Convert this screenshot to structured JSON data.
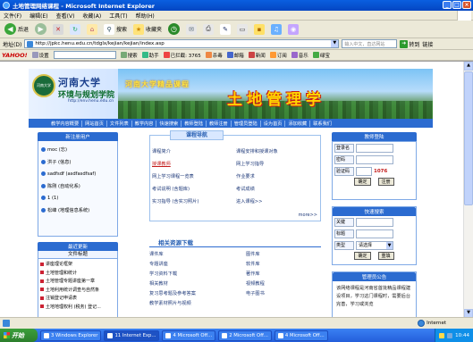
{
  "window": {
    "title": "土地管理网络课程 - Microsoft Internet Explorer"
  },
  "menu": [
    "文件(F)",
    "编辑(E)",
    "查看(V)",
    "收藏(A)",
    "工具(T)",
    "帮助(H)"
  ],
  "toolbar": {
    "back": "后退",
    "search": "搜索",
    "favorites": "收藏夹"
  },
  "address": {
    "label": "地址(D)",
    "url": "http://jpkc.henu.edu.cn/tdglx/kejian/kejian/index.asp",
    "search_placeholder": "输入中文，直达网站",
    "go": "转到",
    "links": "链接"
  },
  "yahoo": {
    "logo": "YAHOO!",
    "settings": "设置",
    "search": "搜索",
    "helper": "助手",
    "blocked": "已拦截: 3765",
    "star": "杀毒",
    "mail": "邮箱",
    "news": "新闻",
    "subscribe": "订阅",
    "music": "音乐",
    "pic": "绿宝"
  },
  "banner": {
    "logo_text": "河南大学",
    "uni_name": "河南大学",
    "uni_sub": "环境与规划学院",
    "uni_url": "http://env.henu.edu.cn",
    "course_line": "河南大学精品课程",
    "course_name": "土地管理学"
  },
  "nav": [
    "教学内容概要",
    "网站首页",
    "文件列表",
    "教学内容",
    "快速搜索",
    "教师登陆",
    "教师注册",
    "管理员登陆",
    "设为首页",
    "添加收藏",
    "联系我们"
  ],
  "online_users": {
    "heading": "新注册用户",
    "items": [
      "moc (忘)",
      "洪子 (信息)",
      "sadfsdf (asdfasdfsaf)",
      "陈刚 (自动化系)",
      "1 (1)",
      "松峰 (地理信息系统)"
    ]
  },
  "latest": {
    "heading": "最近更新",
    "subheading": "文件标题",
    "items": [
      "讲座理论框架",
      "土地管理和统计",
      "土地管理专题讲座第一章",
      "土地利用统计调查与自然条",
      "注销登记申请表",
      "土地地理权利 (税务) 登记..."
    ]
  },
  "course_nav": {
    "caption": "课程导航",
    "items": [
      {
        "label": "课程简介",
        "red": false
      },
      {
        "label": "课程安排和授课对象",
        "red": false
      },
      {
        "label": "授课教师",
        "red": true
      },
      {
        "label": "网上学习指导",
        "red": false
      },
      {
        "label": "网上学习课程一览表",
        "red": false
      },
      {
        "label": "作业要求",
        "red": false
      },
      {
        "label": "考试说明 (含题库)",
        "red": false
      },
      {
        "label": "考试成绩",
        "red": false
      },
      {
        "label": "实习指导 (含实习照片)",
        "red": false
      },
      {
        "label": "进入课程>>",
        "red": false
      }
    ],
    "more": "more>>"
  },
  "resources": {
    "caption": "相关资源下载",
    "items": [
      "课件库",
      "图件库",
      "专题讲座",
      "软件库",
      "学习资料下载",
      "著作库",
      "相关教材",
      "视频教程",
      "复习思考题及参考答案",
      "电子图书",
      "教学素材照片与视频",
      ""
    ]
  },
  "login": {
    "heading": "教师登陆",
    "username_label": "登录名",
    "password_label": "密码",
    "code_label": "验证码",
    "code": "1076",
    "submit": "确定",
    "register": "注册"
  },
  "quick_search": {
    "heading": "快速搜索",
    "keyword_label": "关键",
    "title_label": "标题",
    "type_label": "类型",
    "type_value": "请选择",
    "submit": "确定",
    "reset": "重填"
  },
  "management": {
    "heading": "管理员公告",
    "text": "该网络课程是河南省首批精品课程建设项目，学习这门课程时，需要后台完善，学习或浏览"
  },
  "status": {
    "zone": "Internet"
  },
  "taskbar": {
    "start": "开始",
    "tasks": [
      "3 Windows Explorer",
      "11 Internet Exp...",
      "4 Microsoft Off...",
      "2 Microsoft Off...",
      "4 Microsoft Off..."
    ],
    "time": "10:44"
  }
}
